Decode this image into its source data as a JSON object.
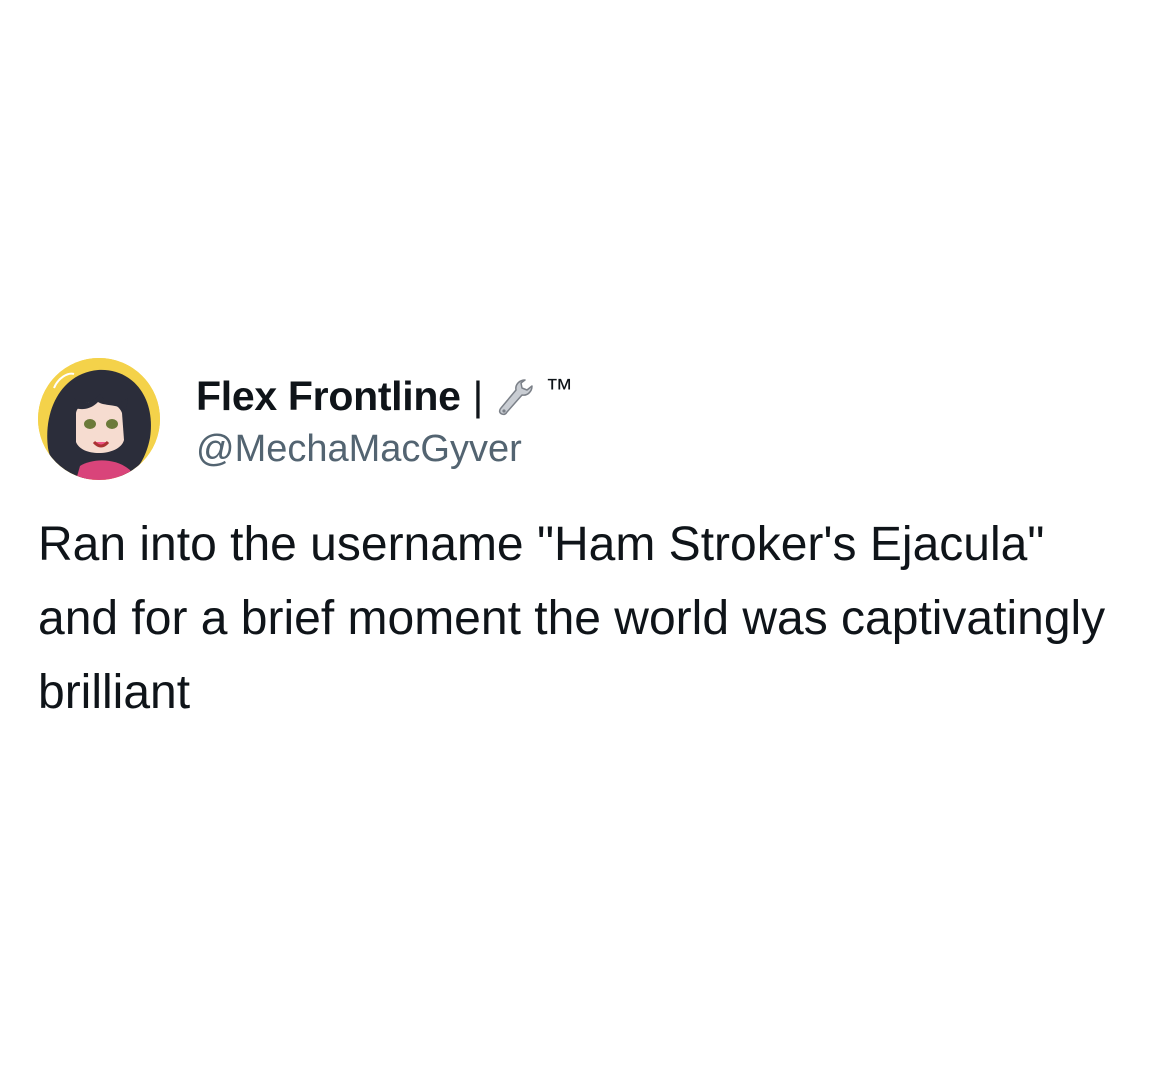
{
  "author": {
    "display_name": "Flex Frontline",
    "separator": "|",
    "emoji_icon": "wrench-icon",
    "tm": "™",
    "handle": "@MechaMacGyver"
  },
  "tweet": {
    "text": "Ran into the username \"Ham Stroker's Ejacula\" and for a brief moment the world was captivatingly brilliant"
  },
  "colors": {
    "text_primary": "#0f1419",
    "text_secondary": "#536471",
    "background": "#ffffff",
    "avatar_bg": "#f4d24a"
  }
}
